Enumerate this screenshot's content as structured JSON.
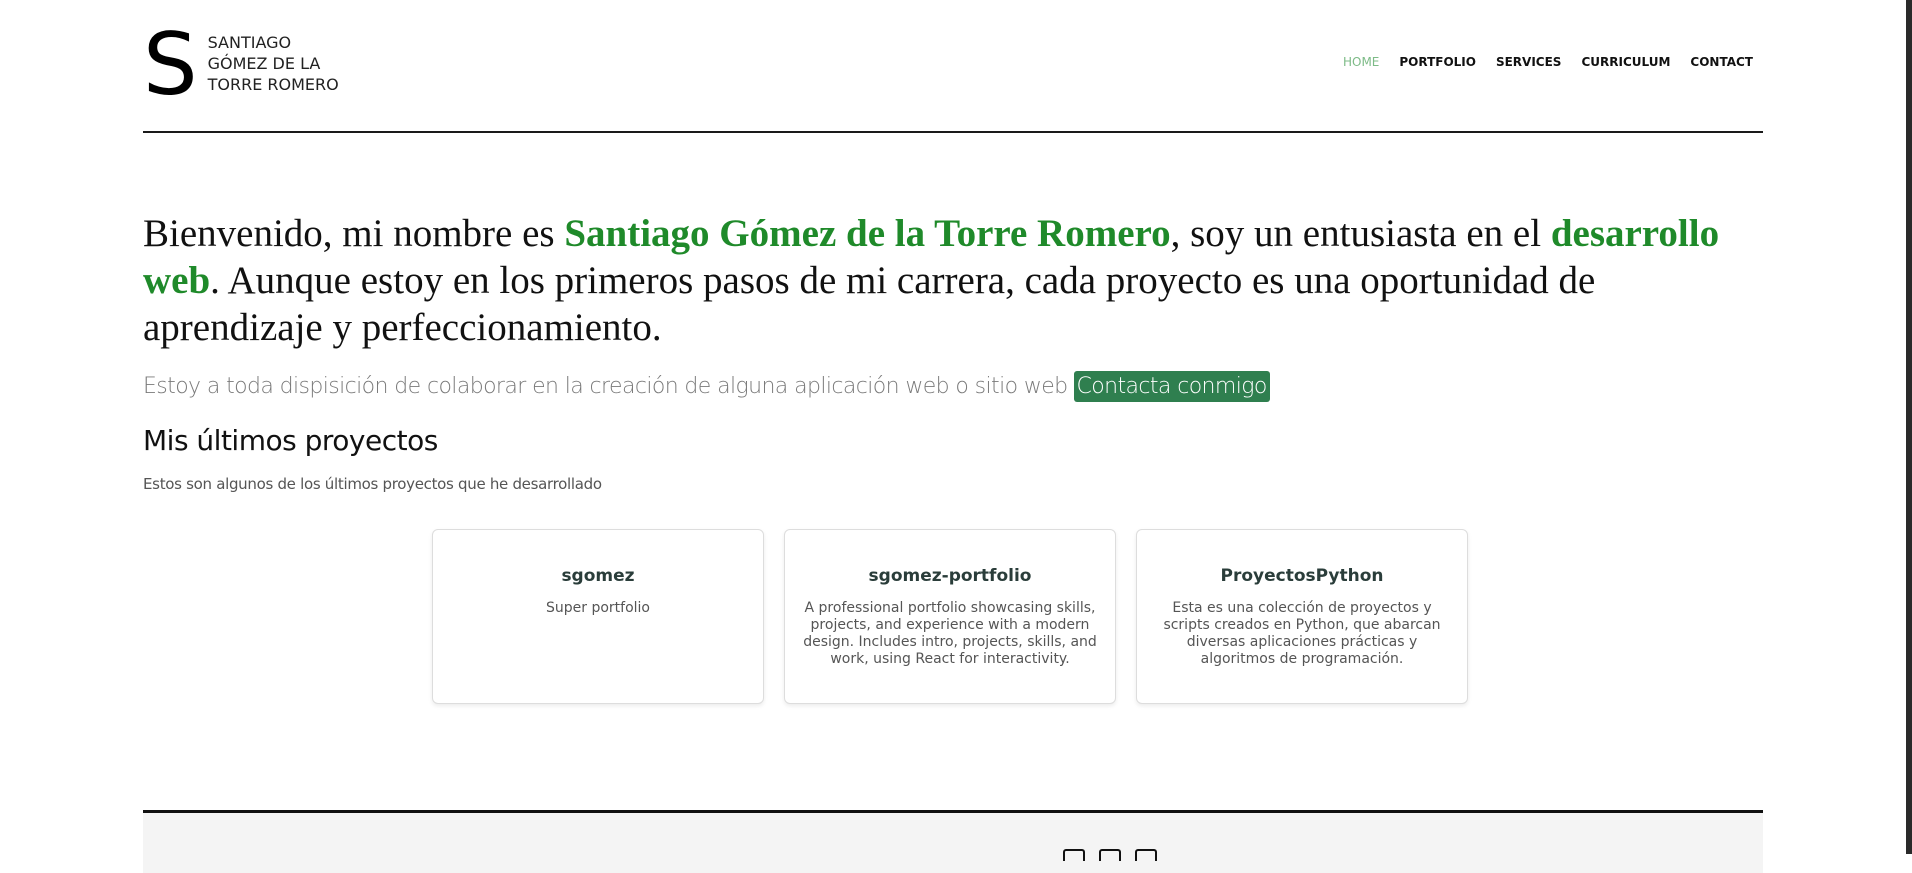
{
  "logo": {
    "letter": "S",
    "name_line1": "SANTIAGO",
    "name_line2": "GÓMEZ DE LA",
    "name_line3": "TORRE ROMERO"
  },
  "nav": {
    "items": [
      {
        "label": "HOME",
        "active": true
      },
      {
        "label": "PORTFOLIO",
        "active": false
      },
      {
        "label": "SERVICES",
        "active": false
      },
      {
        "label": "CURRICULUM",
        "active": false
      },
      {
        "label": "CONTACT",
        "active": false
      }
    ]
  },
  "hero": {
    "part1": "Bienvenido, mi nombre es ",
    "name": "Santiago Gómez de la Torre Romero",
    "part2": ", soy un entusiasta en el ",
    "field": "desarrollo web",
    "part3": ". Aunque estoy en los primeros pasos de mi carrera, cada proyecto es una oportunidad de aprendizaje y perfeccionamiento."
  },
  "lead": {
    "text": "Estoy a toda dispisición de colaborar en la creación de alguna aplicación web o sitio web",
    "button": "Contacta conmigo"
  },
  "projects": {
    "title": "Mis últimos proyectos",
    "subtitle": "Estos son algunos de los últimos proyectos que he desarrollado",
    "items": [
      {
        "name": "sgomez",
        "description": "Super portfolio"
      },
      {
        "name": "sgomez-portfolio",
        "description": "A professional portfolio showcasing skills, projects, and experience with a modern design. Includes intro, projects, skills, and work, using React for interactivity."
      },
      {
        "name": "ProyectosPython",
        "description": "Esta es una colección de proyectos y scripts creados en Python, que abarcan diversas aplicaciones prácticas y algoritmos de programación."
      }
    ]
  },
  "footer": {
    "icons": [
      "instagram-icon",
      "github-icon",
      "linkedin-icon"
    ]
  },
  "colors": {
    "accent": "#1f8a2a",
    "nav_active": "#7dbb87",
    "button_bg": "#2f7f4f"
  }
}
